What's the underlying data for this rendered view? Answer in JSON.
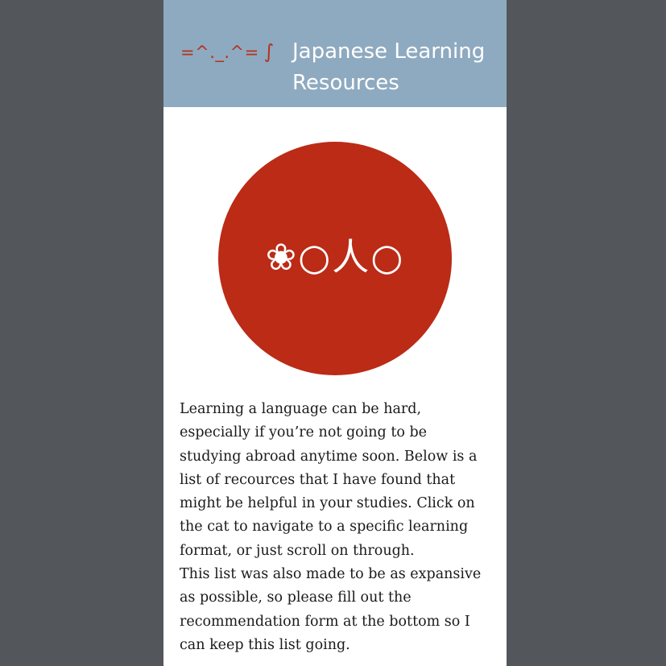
{
  "header": {
    "cat_face": "=^._.^=",
    "cat_tail": "∫",
    "title": "Japanese Learning Resources"
  },
  "hero": {
    "face": "❀○人○"
  },
  "intro": {
    "paragraph1": "Learning a language can be hard, especially if you’re not going to be studying abroad anytime soon. Below is a list of recources that I have found that might be helpful in your studies. Click on the cat to navigate to a specific learning format, or just scroll on through.",
    "paragraph2": "This list was also made to be as expansive as possible, so please fill out the recommendation form at the bottom so I can keep this list going."
  },
  "colors": {
    "background": "#53575b",
    "header": "#8eaac0",
    "accent": "#bb2b16",
    "text": "#1a1a1a"
  }
}
